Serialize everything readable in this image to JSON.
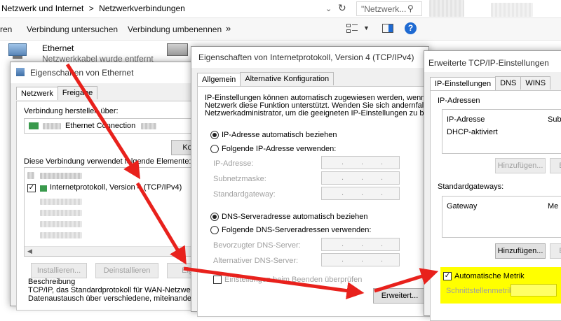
{
  "explorer": {
    "breadcrumb": [
      "Netzwerk und Internet",
      ">",
      "Netzwerkverbindungen"
    ],
    "search_placeholder": "\"Netzwerk...",
    "commands": {
      "first": "ren",
      "diagnose": "Verbindung untersuchen",
      "rename": "Verbindung umbenennen",
      "more": "»"
    },
    "adapter": {
      "name": "Ethernet",
      "status": "Netzwerkkabel wurde entfernt"
    }
  },
  "ethernet_dialog": {
    "title": "Eigenschaften von Ethernet",
    "tabs": [
      "Netzwerk",
      "Freigabe"
    ],
    "connect_using_label": "Verbindung herstellen über:",
    "adapter_name": "Ethernet Connection",
    "configure_button": "Konfigu",
    "items_label": "Diese Verbindung verwendet folgende Elemente:",
    "items": [
      {
        "label": "",
        "checked": true
      },
      {
        "label": "Internetprotokoll, Version 4 (TCP/IPv4)",
        "checked": true
      }
    ],
    "install_button": "Installieren...",
    "uninstall_button": "Deinstallieren",
    "properties_button": "Eigens",
    "description_title": "Beschreibung",
    "description_line1": "TCP/IP, das Standardprotokoll für WAN-Netzwerke, da",
    "description_line2": "Datenaustausch über verschiedene, miteinander verbu"
  },
  "ipv4_dialog": {
    "title": "Eigenschaften von Internetprotokoll, Version 4 (TCP/IPv4)",
    "tabs": [
      "Allgemein",
      "Alternative Konfiguration"
    ],
    "intro_line1": "IP-Einstellungen können automatisch zugewiesen werden, wenn das",
    "intro_line2": "Netzwerk diese Funktion unterstützt. Wenden Sie sich andernfalls an den",
    "intro_line3": "Netzwerkadministrator, um die geeigneten IP-Einstellungen zu beziehen.",
    "auto_ip": "IP-Adresse automatisch beziehen",
    "manual_ip": "Folgende IP-Adresse verwenden:",
    "ip_label": "IP-Adresse:",
    "subnet_label": "Subnetzmaske:",
    "gateway_label": "Standardgateway:",
    "auto_dns": "DNS-Serveradresse automatisch beziehen",
    "manual_dns": "Folgende DNS-Serveradressen verwenden:",
    "preferred_dns_label": "Bevorzugter DNS-Server:",
    "alternate_dns_label": "Alternativer DNS-Server:",
    "validate_label": "Einstellungen beim Beenden überprüfen",
    "advanced_button": "Erweitert..."
  },
  "advanced_dialog": {
    "title": "Erweiterte TCP/IP-Einstellungen",
    "tabs": [
      "IP-Einstellungen",
      "DNS",
      "WINS"
    ],
    "ip_section": "IP-Adressen",
    "ip_col1": "IP-Adresse",
    "ip_col2": "Sub",
    "ip_row": "DHCP-aktiviert",
    "add_button": "Hinzufügen...",
    "edit_button": "Be",
    "gw_section": "Standardgateways:",
    "gw_col1": "Gateway",
    "gw_col2": "Me",
    "add_button2": "Hinzufügen...",
    "edit_button2": "Be",
    "auto_metric": "Automatische Metrik",
    "iface_metric_label": "Schnittstellenmetrik:"
  },
  "colors": {
    "arrow": "#e8211c",
    "highlight": "#ffff00",
    "link_blue": "#1e6ad2"
  }
}
